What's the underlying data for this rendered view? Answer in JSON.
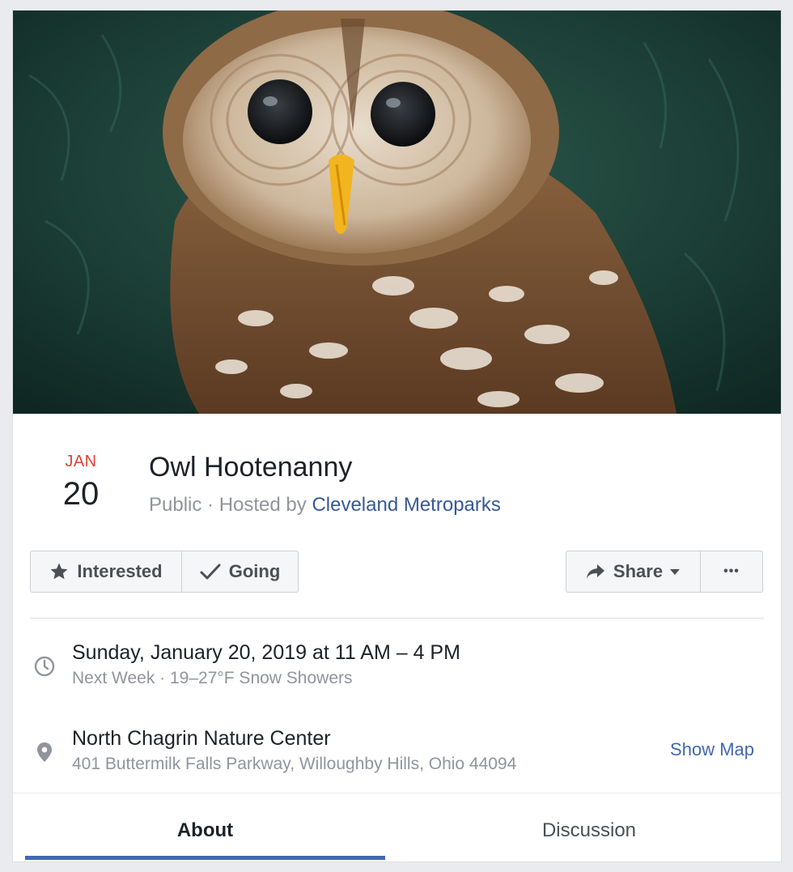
{
  "event": {
    "month": "JAN",
    "day": "20",
    "title": "Owl Hootenanny",
    "privacy": "Public",
    "separator": " · ",
    "hosted_by_prefix": "Hosted by ",
    "host": "Cleveland Metroparks"
  },
  "actions": {
    "interested_label": "Interested",
    "going_label": "Going",
    "share_label": "Share",
    "more_label": "•••"
  },
  "details": {
    "datetime": "Sunday, January 20, 2019 at 11 AM – 4 PM",
    "relative_and_weather": "Next Week · 19–27°F Snow Showers",
    "location_name": "North Chagrin Nature Center",
    "location_address": "401 Buttermilk Falls Parkway, Willoughby Hills, Ohio 44094",
    "show_map_label": "Show Map"
  },
  "tabs": [
    {
      "label": "About",
      "active": true
    },
    {
      "label": "Discussion",
      "active": false
    }
  ],
  "colors": {
    "month": "#e4403a",
    "link": "#385898",
    "accent": "#4267b2",
    "muted": "#90949c"
  },
  "icons": {
    "interested": "star-icon",
    "going": "check-icon",
    "share": "share-arrow-icon",
    "share_menu": "caret-down-icon",
    "time": "clock-icon",
    "location": "map-pin-icon"
  }
}
